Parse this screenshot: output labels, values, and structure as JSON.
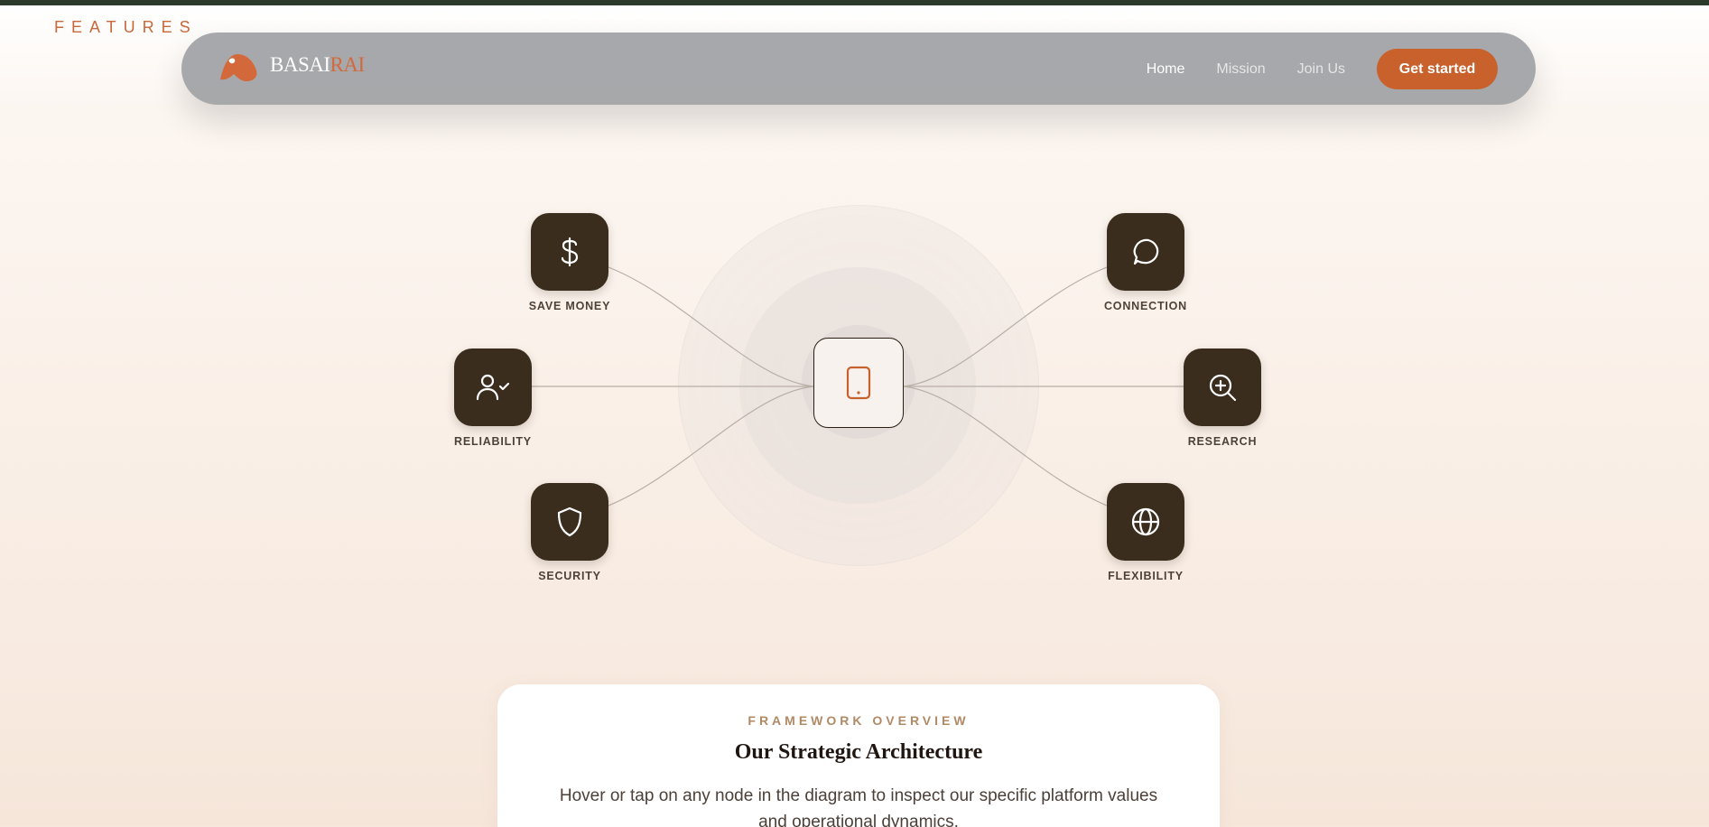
{
  "section_label": "FEATURES",
  "nav": {
    "logo_text_main": "BASAI",
    "logo_text_accent": "RAI",
    "links": [
      "Home",
      "Mission",
      "Join Us"
    ],
    "cta_label": "Get started"
  },
  "diagram": {
    "hub_icon": "tablet-icon",
    "nodes": [
      {
        "label": "SAVE MONEY",
        "icon": "dollar-icon"
      },
      {
        "label": "RELIABILITY",
        "icon": "user-check-icon"
      },
      {
        "label": "SECURITY",
        "icon": "shield-icon"
      },
      {
        "label": "CONNECTION",
        "icon": "chat-bubble-icon"
      },
      {
        "label": "RESEARCH",
        "icon": "zoom-in-icon"
      },
      {
        "label": "FLEXIBILITY",
        "icon": "globe-icon"
      }
    ]
  },
  "card": {
    "eyebrow": "FRAMEWORK OVERVIEW",
    "title": "Our Strategic Architecture",
    "description": "Hover or tap on any node in the diagram to inspect our specific platform values and operational dynamics."
  },
  "colors": {
    "accent": "#c8612c",
    "node_bg": "#3a2d1e",
    "top_bar": "#2c3a2b"
  }
}
